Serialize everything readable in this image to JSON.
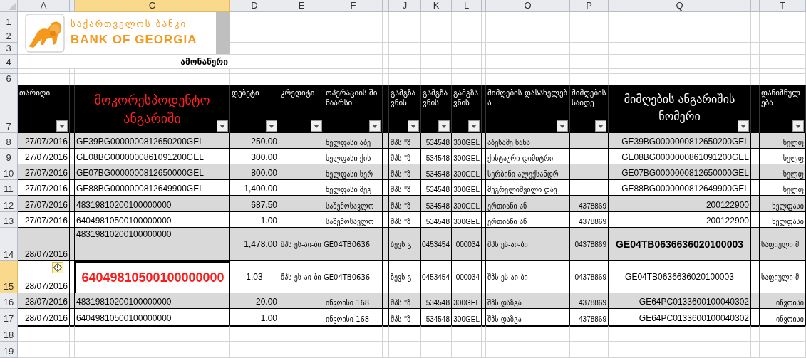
{
  "column_headers": [
    {
      "label": "A",
      "selected": false
    },
    {
      "label": "C",
      "selected": true
    },
    {
      "label": "D",
      "selected": false
    },
    {
      "label": "E",
      "selected": false
    },
    {
      "label": "F",
      "selected": false
    },
    {
      "label": "J",
      "selected": false
    },
    {
      "label": "K",
      "selected": false
    },
    {
      "label": "L",
      "selected": false
    },
    {
      "label": "O",
      "selected": false
    },
    {
      "label": "P",
      "selected": false
    },
    {
      "label": "Q",
      "selected": false
    },
    {
      "label": "T",
      "selected": false
    }
  ],
  "row_numbers": [
    {
      "label": "1",
      "selected": false
    },
    {
      "label": "2",
      "selected": false
    },
    {
      "label": "3",
      "selected": false
    },
    {
      "label": "4",
      "selected": false
    },
    {
      "selected": false
    },
    {
      "label": "6",
      "selected": false
    },
    {
      "label": "7",
      "selected": false
    },
    {
      "label": "8",
      "selected": false
    },
    {
      "label": "9",
      "selected": false
    },
    {
      "label": "10",
      "selected": false
    },
    {
      "label": "11",
      "selected": false
    },
    {
      "label": "12",
      "selected": false
    },
    {
      "label": "13",
      "selected": false
    },
    {
      "label": "14",
      "selected": false
    },
    {
      "label": "15",
      "selected": true
    },
    {
      "label": "16",
      "selected": false
    },
    {
      "label": "17",
      "selected": false
    },
    {
      "label": "18",
      "selected": false
    },
    {
      "label": "19",
      "selected": false
    }
  ],
  "logo": {
    "name_georgian": "საქართველოს ბანკი",
    "name_english": "BANK OF GEORGIA"
  },
  "sheet_title": "ამონაწერი",
  "table": {
    "columns": [
      {
        "label": "თარიღი",
        "kind": "plain"
      },
      {
        "label": "მოკორესპოდენტო ანგარიში",
        "kind": "red"
      },
      {
        "label": "დებეტი",
        "kind": "plain"
      },
      {
        "label": "კრედიტი",
        "kind": "plain"
      },
      {
        "label": "ოპერაციის შინაარსი",
        "kind": "plain"
      },
      {
        "label": "გამგზავნის",
        "kind": "plain"
      },
      {
        "label": "გამგზავნის",
        "kind": "plain"
      },
      {
        "label": "გამგზავნის",
        "kind": "plain"
      },
      {
        "label": "მიმღების დასახელება",
        "kind": "plain"
      },
      {
        "label": "მიმღების საიდე",
        "kind": "plain"
      },
      {
        "label": "მიმღების ანგარიშის ნომერი",
        "kind": "large"
      },
      {
        "label": "დანიშნულება",
        "kind": "plain"
      }
    ],
    "rows": [
      {
        "shaded": true,
        "date": "27/07/2016",
        "correspondent_account": "GE39BG0000000812650200GEL",
        "debit": "250.00",
        "content": "ხელფასი აბე",
        "sender_name": "შპს \"ზ",
        "sender_id": "534548",
        "sender_account": "300GEL",
        "recipient_name": "აბესამე ნანა",
        "recipient_account": "GE39BG0000000812650200GEL",
        "purpose": "ხელფ"
      },
      {
        "shaded": false,
        "date": "27/07/2016",
        "correspondent_account": "GE08BG0000000861091200GEL",
        "debit": "300.00",
        "content": "ხელფასი ქის",
        "sender_name": "შპს \"ზ",
        "sender_id": "534548",
        "sender_account": "300GEL",
        "recipient_name": "ქისტაური დიმიტრი",
        "recipient_account": "GE08BG0000000861091200GEL",
        "purpose": "ხელფ"
      },
      {
        "shaded": true,
        "date": "27/07/2016",
        "correspondent_account": "GE07BG0000000812650000GEL",
        "debit": "800.00",
        "content": "ხელფასი სერ",
        "sender_name": "შპს \"ზ",
        "sender_id": "534548",
        "sender_account": "300GEL",
        "recipient_name": "სერბინი ალექსანდრ",
        "recipient_account": "GE07BG0000000812650000GEL",
        "purpose": "ხელფ"
      },
      {
        "shaded": false,
        "date": "27/07/2016",
        "correspondent_account": "GE88BG0000000812649900GEL",
        "debit": "1,400.00",
        "content": "ხელფასი მეგ",
        "sender_name": "შპს \"ზ",
        "sender_id": "534548",
        "sender_account": "300GEL",
        "recipient_name": "მეგრელიშვილი დავ",
        "recipient_account": "GE88BG0000000812649900GEL",
        "purpose": "ხელფ"
      },
      {
        "shaded": true,
        "date": "27/07/2016",
        "correspondent_account": "48319810200100000000",
        "debit": "687.50",
        "content": "საშემოსავლო",
        "sender_name": "შპს \"ზ",
        "sender_id": "534548",
        "sender_account": "300GEL",
        "recipient_name": "ერთიანი ან",
        "recipient_id": "4378869",
        "recipient_account": "200122900",
        "purpose": "ხელფასი"
      },
      {
        "shaded": false,
        "date": "27/07/2016",
        "correspondent_account": "64049810500100000000",
        "debit": "1.00",
        "content": "საშემოსავლო",
        "sender_name": "შპს \"ზ",
        "sender_id": "534548",
        "sender_account": "300GEL",
        "recipient_name": "ერთიანი ან",
        "recipient_id": "4378869",
        "recipient_account": "200122900",
        "purpose": "ხელფასი"
      },
      {
        "shaded": true,
        "big_recipient_account": true,
        "date": "28/07/2016",
        "correspondent_account": "48319810200100000000",
        "debit": "1,478.00",
        "credit": "შპს ეს-აი-ბი GE04TB0636",
        "sender_name": "ზევს გ",
        "sender_id": "0453454",
        "sender_account": "000034",
        "recipient_name": "შპს ეს-აი-ბი",
        "recipient_id": "04378869",
        "recipient_account": "GE04TB0636636020100003",
        "purpose": "საფიული მ"
      },
      {
        "shaded": false,
        "big_correspondent_account": true,
        "warning": true,
        "date": "28/07/2016",
        "correspondent_account": "64049810500100000000",
        "debit": "1.03",
        "credit": "შპს ეს-აი-ბი GE04TB0636",
        "sender_name": "ზევს გ",
        "sender_id": "0453454",
        "sender_account": "000034",
        "recipient_name": "შპს ეს-აი-ბი",
        "recipient_id": "04378869",
        "recipient_account": "GE04TB0636636020100003",
        "purpose": "საფიული მ"
      },
      {
        "shaded": true,
        "date": "28/07/2016",
        "correspondent_account": "48319810200100000000",
        "debit": "20.00",
        "content": "ინვოისი 168",
        "sender_name": "შპს \"ზ",
        "sender_id": "534548",
        "sender_account": "300GEL",
        "recipient_name": "შპს დაზგა",
        "recipient_id": "4378869",
        "recipient_account": "GE64PC0133600100040302",
        "purpose": "ინვოისი"
      },
      {
        "shaded": false,
        "date": "28/07/2016",
        "correspondent_account": "64049810500100000000",
        "debit": "1.00",
        "content": "ინვოისი 168",
        "sender_name": "შპს \"ზ",
        "sender_id": "534548",
        "sender_account": "300GEL",
        "recipient_name": "შპს დაზგა",
        "recipient_id": "4378869",
        "recipient_account": "GE64PC0133600100040302",
        "purpose": "ინვოისი"
      }
    ]
  }
}
